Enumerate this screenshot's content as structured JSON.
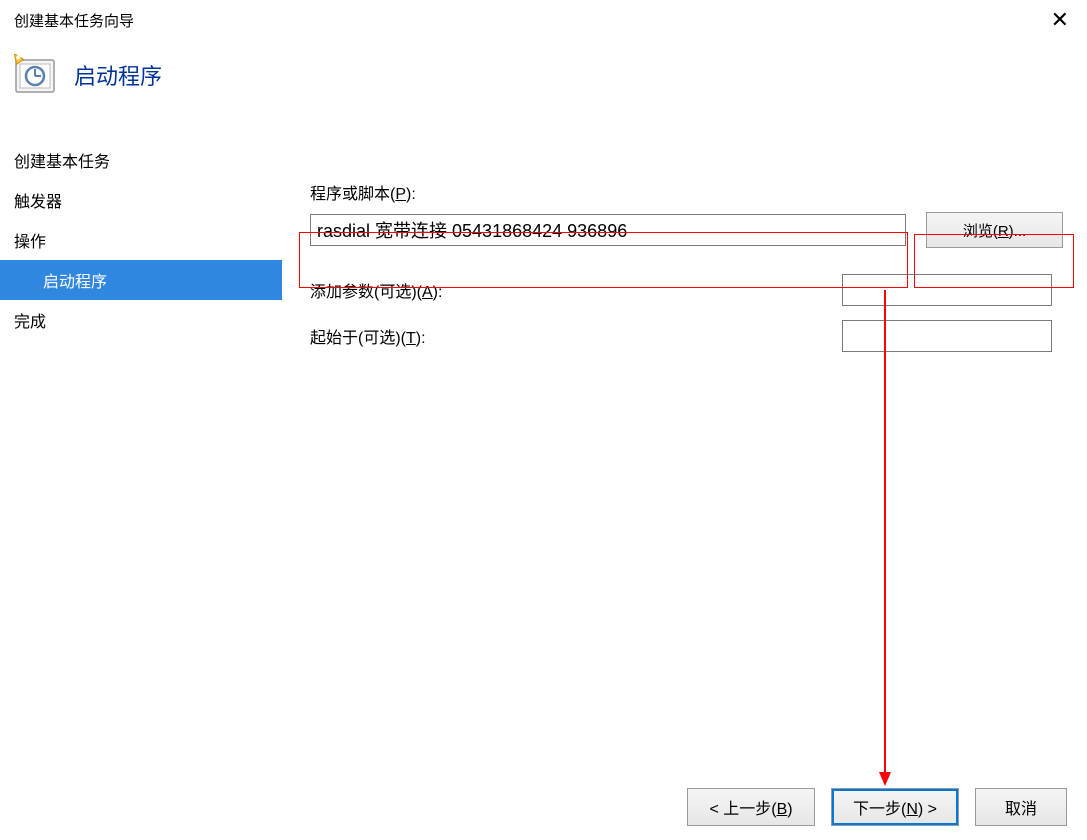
{
  "window": {
    "title": "创建基本任务向导"
  },
  "header": {
    "title": "启动程序"
  },
  "sidebar": {
    "items": [
      {
        "label": "创建基本任务",
        "indent": false,
        "selected": false
      },
      {
        "label": "触发器",
        "indent": false,
        "selected": false
      },
      {
        "label": "操作",
        "indent": false,
        "selected": false
      },
      {
        "label": "启动程序",
        "indent": true,
        "selected": true
      },
      {
        "label": "完成",
        "indent": false,
        "selected": false
      }
    ]
  },
  "main": {
    "program_label": "程序或脚本(",
    "program_mnemonic": "P",
    "program_label_end": "):",
    "program_value": "rasdial 宽带连接 05431868424 936896",
    "browse_label": "浏览(",
    "browse_mnemonic": "R",
    "browse_label_end": ")...",
    "args_label": "添加参数(可选)(",
    "args_mnemonic": "A",
    "args_label_end": "):",
    "args_value": "",
    "startin_label": "起始于(可选)(",
    "startin_mnemonic": "T",
    "startin_label_end": "):",
    "startin_value": ""
  },
  "buttons": {
    "back": "< 上一步(",
    "back_mnemonic": "B",
    "back_end": ")",
    "next": "下一步(",
    "next_mnemonic": "N",
    "next_end": ") >",
    "cancel": "取消"
  }
}
